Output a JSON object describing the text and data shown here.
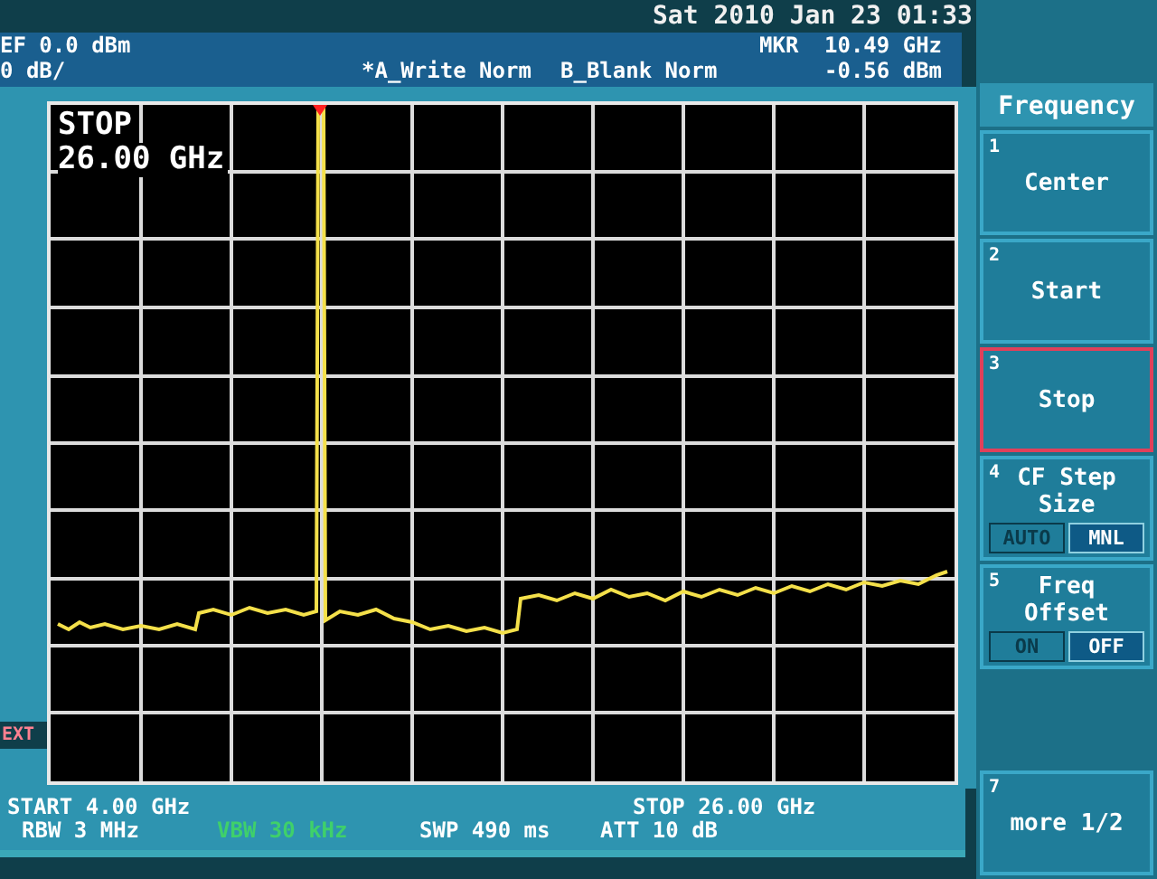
{
  "clock": "Sat 2010 Jan 23 01:33",
  "header": {
    "ref_level": "EF 0.0 dBm",
    "scale": "0 dB/",
    "trace_a": "*A_Write Norm",
    "trace_b": "B_Blank Norm",
    "marker_label": "MKR",
    "marker_freq": "10.49 GHz",
    "marker_level": "-0.56 dBm"
  },
  "graph": {
    "edit_label": "STOP",
    "edit_value": "26.00 GHz"
  },
  "side_label": "EXT",
  "status": {
    "start": "START 4.00 GHz",
    "stop": "STOP 26.00 GHz",
    "rbw": "RBW 3 MHz",
    "vbw": "VBW 30 kHz",
    "sweep": "SWP 490 ms",
    "attenuation": "ATT 10 dB"
  },
  "menu": {
    "title": "Frequency",
    "keys": [
      {
        "number": "1",
        "kind": "plain",
        "label": "Center",
        "selected": false
      },
      {
        "number": "2",
        "kind": "plain",
        "label": "Start",
        "selected": false
      },
      {
        "number": "3",
        "kind": "plain",
        "label": "Stop",
        "selected": true
      },
      {
        "number": "4",
        "kind": "toggle",
        "label": "CF Step Size",
        "selected": false,
        "options": [
          {
            "label": "AUTO",
            "selected": false
          },
          {
            "label": "MNL",
            "selected": true
          }
        ]
      },
      {
        "number": "5",
        "kind": "toggle",
        "label": "Freq Offset",
        "selected": false,
        "options": [
          {
            "label": "ON",
            "selected": false
          },
          {
            "label": "OFF",
            "selected": true
          }
        ]
      },
      {
        "number": "7",
        "kind": "plain",
        "label": "more 1/2",
        "selected": false
      }
    ]
  }
}
